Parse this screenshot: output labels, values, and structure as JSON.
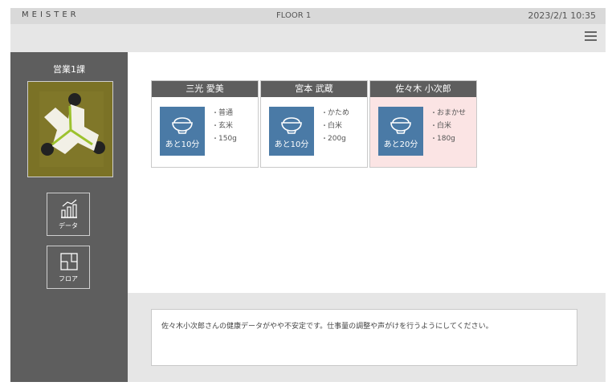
{
  "topbar": {
    "brand": "MEISTER",
    "floor": "FLOOR 1",
    "datetime": "2023/2/1 10:35"
  },
  "header": {
    "menu_icon": "hamburger-menu-icon"
  },
  "sidebar": {
    "team_name": "営業1課",
    "nav": [
      {
        "label": "データ",
        "icon": "data-chart-icon"
      },
      {
        "label": "フロア",
        "icon": "floor-plan-icon"
      }
    ]
  },
  "cards": [
    {
      "name": "三光 愛美",
      "timer": "あと10分",
      "prefs": [
        "普通",
        "玄米",
        "150g"
      ],
      "alert": false
    },
    {
      "name": "宮本 武蔵",
      "timer": "あと10分",
      "prefs": [
        "かため",
        "白米",
        "200g"
      ],
      "alert": false
    },
    {
      "name": "佐々木 小次郎",
      "timer": "あと20分",
      "prefs": [
        "おまかせ",
        "白米",
        "180g"
      ],
      "alert": true
    }
  ],
  "message": "佐々木小次郎さんの健康データがやや不安定です。仕事量の調整や声がけを行うようにしてください。",
  "colors": {
    "sidebar": "#5e5e5e",
    "rice_button": "#4a7aa6",
    "alert_card": "#fbe4e4",
    "bar": "#d9d9d9"
  }
}
